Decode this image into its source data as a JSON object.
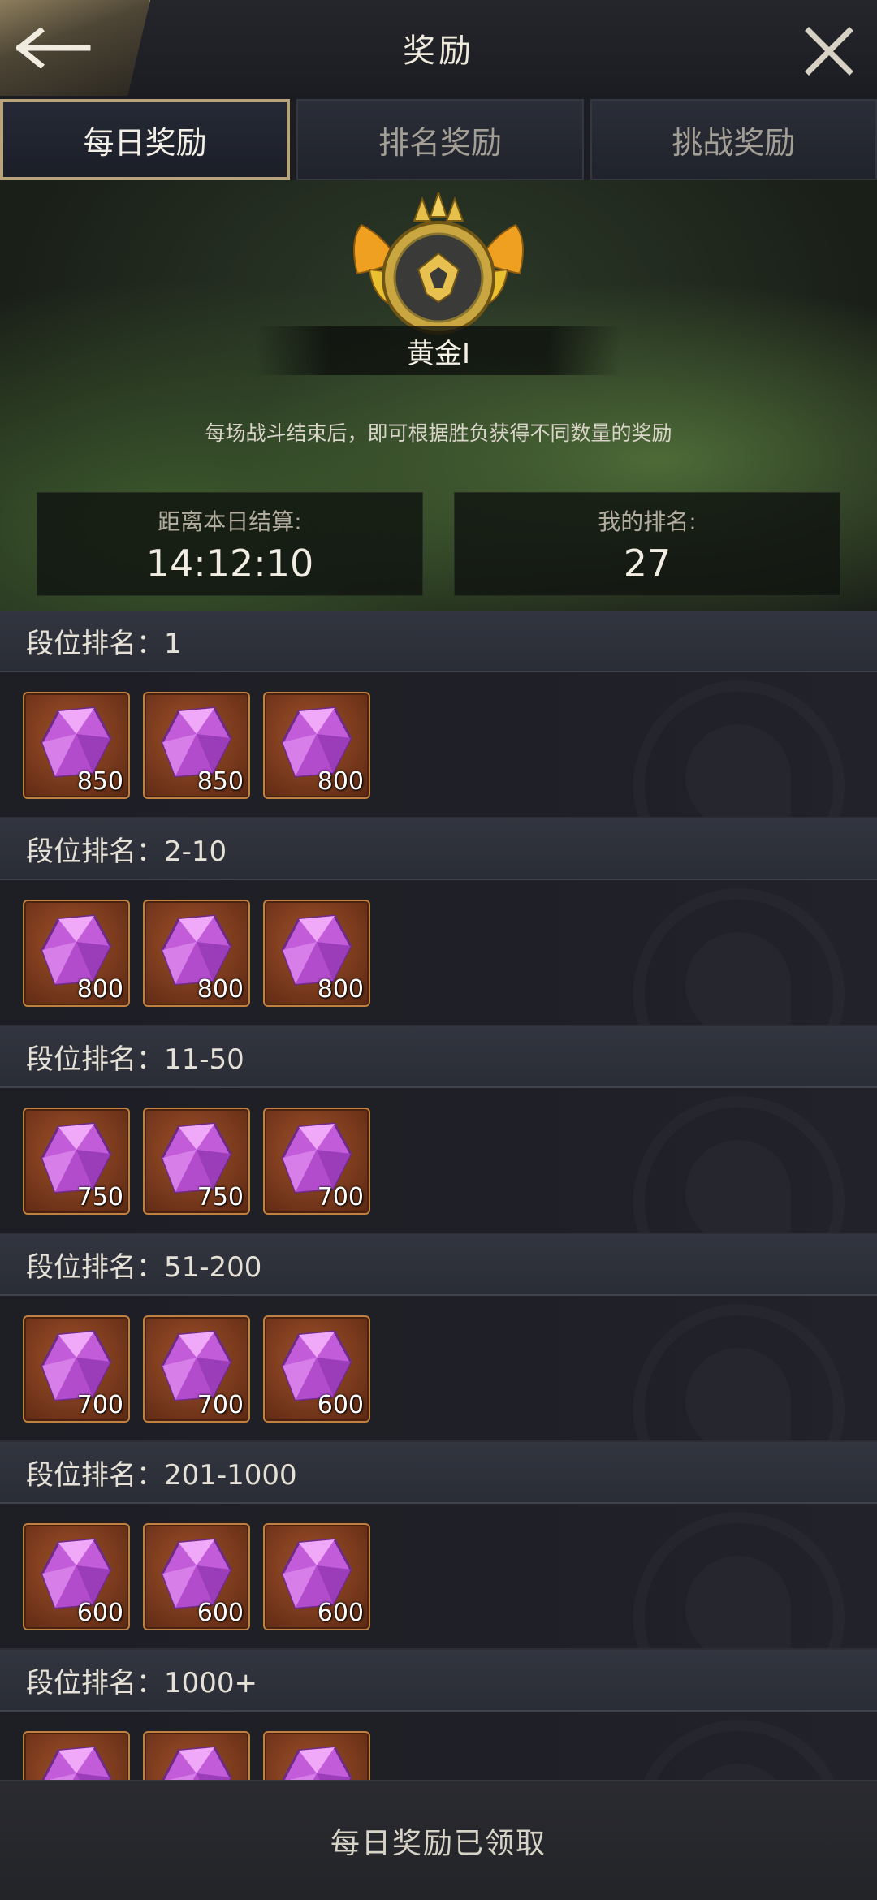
{
  "header": {
    "title": "奖励",
    "back_icon": "arrow-left-icon",
    "close_icon": "close-icon"
  },
  "tabs": [
    {
      "label": "每日奖励",
      "active": true
    },
    {
      "label": "排名奖励",
      "active": false
    },
    {
      "label": "挑战奖励",
      "active": false
    }
  ],
  "rank": {
    "name": "黄金I",
    "emblem_icon": "gold-rank-emblem-icon"
  },
  "description": "每场战斗结束后，即可根据胜负获得不同数量的奖励",
  "countdown": {
    "label": "距离本日结算:",
    "value": "14:12:10"
  },
  "my_rank": {
    "label": "我的排名:",
    "value": "27"
  },
  "tiers": [
    {
      "label": "段位排名：1",
      "rewards": [
        "850",
        "850",
        "800"
      ]
    },
    {
      "label": "段位排名：2-10",
      "rewards": [
        "800",
        "800",
        "800"
      ]
    },
    {
      "label": "段位排名：11-50",
      "rewards": [
        "750",
        "750",
        "700"
      ]
    },
    {
      "label": "段位排名：51-200",
      "rewards": [
        "700",
        "700",
        "600"
      ]
    },
    {
      "label": "段位排名：201-1000",
      "rewards": [
        "600",
        "600",
        "600"
      ]
    },
    {
      "label": "段位排名：1000+",
      "rewards": [
        "",
        "",
        ""
      ]
    }
  ],
  "reward_icon": "purple-gem-icon",
  "footer": {
    "status": "每日奖励已领取"
  },
  "colors": {
    "accent_gold": "#b9a37a",
    "item_bg": "#7a3a1d",
    "gem": "#c860e0"
  }
}
